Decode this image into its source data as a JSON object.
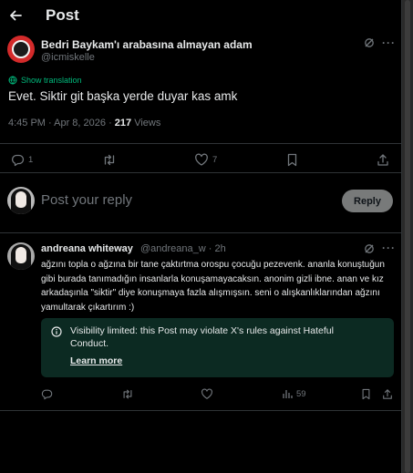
{
  "header": {
    "title": "Post",
    "back_icon": "arrow-left-icon"
  },
  "post": {
    "author_name": "Bedri Baykam'ı arabasına almayan adam",
    "author_handle": "@icmiskelle",
    "show_translation": "Show translation",
    "text": "Evet. Siktir git başka yerde duyar kas amk",
    "timestamp": "4:45 PM · Apr 8, 2026 · ",
    "views_count": "217",
    "views_label": " Views",
    "actions": {
      "replies": "1",
      "reposts": "",
      "likes": "7"
    }
  },
  "composer": {
    "placeholder": "Post your reply",
    "reply_button": "Reply"
  },
  "reply": {
    "author_name": "andreana whiteway",
    "author_handle": "@andreana_w · 2h",
    "text": "ağzını topla o ağzına bir tane çaktırtma orospu çocuğu pezevenk. ananla konuştuğun gibi burada tanımadığın insanlarla konuşamayacaksın. anonim gizli ibne. anan ve kız arkadaşınla \"siktir\" diye konuşmaya fazla alışmışsın. seni o alışkanlıklarından ağzını yamultarak çıkartırım :)",
    "notice": "Visibility limited: this Post may violate X's rules against Hateful Conduct.",
    "learn_more": "Learn more",
    "views": "59"
  },
  "colors": {
    "background": "#000000",
    "text": "#e7e9ea",
    "muted": "#71767b",
    "accent_green": "#00ba7c",
    "notice_bg": "#0c2a22",
    "reply_button_bg": "#787a7a"
  }
}
